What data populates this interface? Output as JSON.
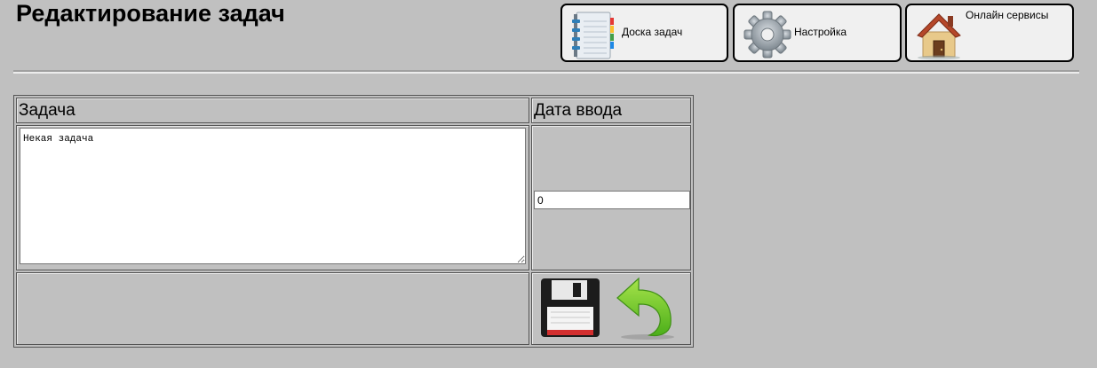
{
  "page": {
    "title": "Редактирование задач"
  },
  "nav": {
    "board_label": "Доска задач",
    "settings_label": "Настройка",
    "online_label": "Онлайн сервисы",
    "board_icon": "address-book-icon",
    "settings_icon": "gear-icon",
    "online_icon": "house-icon"
  },
  "table": {
    "col_task": "Задача",
    "col_date": "Дата ввода",
    "task_value": "Некая задача",
    "date_value": "0"
  },
  "actions": {
    "save_icon": "floppy-disk-icon",
    "back_icon": "undo-arrow-icon"
  },
  "colors": {
    "background": "#c0c0c0",
    "button_bg": "#f0f0f0",
    "back_arrow": "#7ccf1f"
  }
}
